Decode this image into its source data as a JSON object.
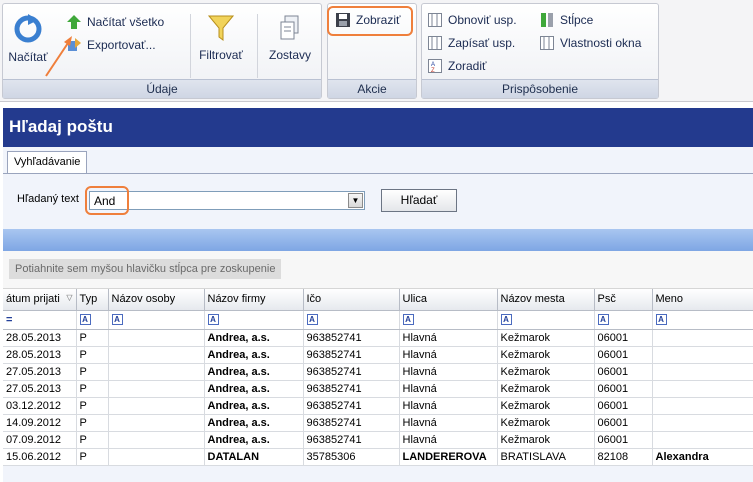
{
  "ribbon": {
    "udaje": {
      "label": "Údaje",
      "nacitat": "Načítať",
      "nacitat_vsetko": "Načítať všetko",
      "exportovat": "Exportovať...",
      "filtrovat": "Filtrovať",
      "zostavy": "Zostavy"
    },
    "akcie": {
      "label": "Akcie",
      "zobrazit": "Zobraziť"
    },
    "prisposobenie": {
      "label": "Prispôsobenie",
      "obnovit": "Obnoviť usp.",
      "zapisat": "Zapísať usp.",
      "zoradit": "Zoradiť",
      "stlpce": "Stĺpce",
      "vlastnosti": "Vlastnosti okna"
    }
  },
  "window": {
    "title": "Hľadaj poštu"
  },
  "tab": {
    "label": "Vyhľadávanie"
  },
  "search": {
    "label": "Hľadaný text",
    "value": "And",
    "button": "Hľadať"
  },
  "grid": {
    "group_hint": "Potiahnite sem myšou hlavičku stĺpca pre zoskupenie",
    "columns": [
      "átum prijati",
      "Typ",
      "Názov osoby",
      "Názov firmy",
      "Ičo",
      "Ulica",
      "Názov mesta",
      "Psč",
      "Meno"
    ],
    "rows": [
      [
        "28.05.2013",
        "P",
        "",
        "Andrea, a.s.",
        "963852741",
        "Hlavná",
        "Kežmarok",
        "06001",
        ""
      ],
      [
        "28.05.2013",
        "P",
        "",
        "Andrea, a.s.",
        "963852741",
        "Hlavná",
        "Kežmarok",
        "06001",
        ""
      ],
      [
        "27.05.2013",
        "P",
        "",
        "Andrea, a.s.",
        "963852741",
        "Hlavná",
        "Kežmarok",
        "06001",
        ""
      ],
      [
        "27.05.2013",
        "P",
        "",
        "Andrea, a.s.",
        "963852741",
        "Hlavná",
        "Kežmarok",
        "06001",
        ""
      ],
      [
        "03.12.2012",
        "P",
        "",
        "Andrea, a.s.",
        "963852741",
        "Hlavná",
        "Kežmarok",
        "06001",
        ""
      ],
      [
        "14.09.2012",
        "P",
        "",
        "Andrea, a.s.",
        "963852741",
        "Hlavná",
        "Kežmarok",
        "06001",
        ""
      ],
      [
        "07.09.2012",
        "P",
        "",
        "Andrea, a.s.",
        "963852741",
        "Hlavná",
        "Kežmarok",
        "06001",
        ""
      ],
      [
        "15.06.2012",
        "P",
        "",
        "DATALAN",
        "35785306",
        "LANDEREROVA",
        "BRATISLAVA",
        "82108",
        "Alexandra"
      ]
    ]
  },
  "colors": {
    "title_band": "#233a8e",
    "callout": "#ef7f3c",
    "blue_strip": "#7ea6e4"
  }
}
